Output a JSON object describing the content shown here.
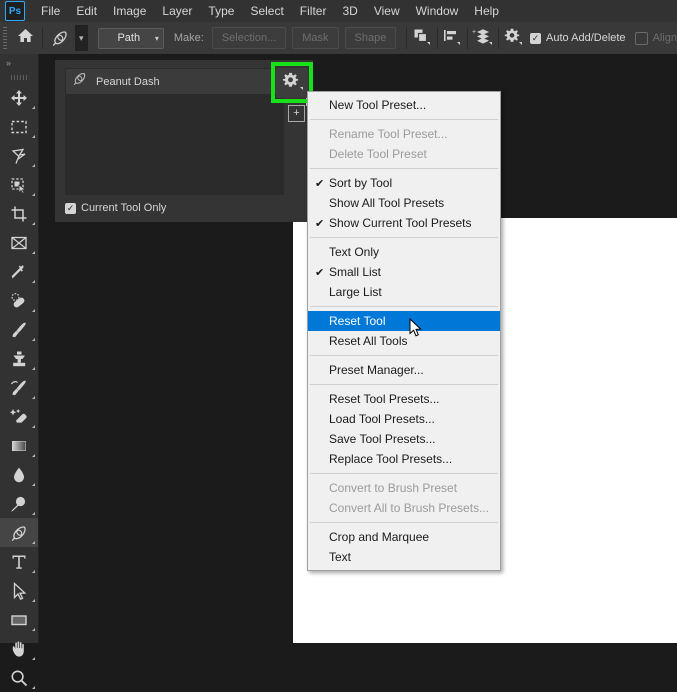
{
  "app": {
    "logo_text": "Ps",
    "menus": [
      "File",
      "Edit",
      "Image",
      "Layer",
      "Type",
      "Select",
      "Filter",
      "3D",
      "View",
      "Window",
      "Help"
    ]
  },
  "options_bar": {
    "home_icon": "home-icon",
    "active_tool_icon": "pen-tool-icon",
    "mode_select": {
      "value": "Path",
      "caret": "⌄"
    },
    "make_label": "Make:",
    "buttons": [
      {
        "label": "Selection...",
        "enabled": false
      },
      {
        "label": "Mask",
        "enabled": false
      },
      {
        "label": "Shape",
        "enabled": false
      }
    ],
    "path_operations_icon": "path-operations-icon",
    "path_alignment_icon": "path-alignment-icon",
    "path_arrangement_icon": "path-arrangement-icon",
    "geometry_options_icon": "gear-icon",
    "auto_add_delete": {
      "label": "Auto Add/Delete",
      "checked": true
    },
    "align": {
      "label": "Align",
      "checked": false,
      "enabled": false
    }
  },
  "toolbar": {
    "collapse_label": "»",
    "tools": [
      {
        "name": "move-tool",
        "icon": "move-icon",
        "selected": false
      },
      {
        "name": "rectangular-marquee-tool",
        "icon": "marquee-icon",
        "selected": false
      },
      {
        "name": "lasso-tool",
        "icon": "lasso-icon",
        "selected": false
      },
      {
        "name": "object-selection-tool",
        "icon": "quick-selection-icon",
        "selected": false
      },
      {
        "name": "crop-tool",
        "icon": "crop-icon",
        "selected": false
      },
      {
        "name": "frame-tool",
        "icon": "frame-icon",
        "selected": false
      },
      {
        "name": "eyedropper-tool",
        "icon": "eyedropper-icon",
        "selected": false
      },
      {
        "name": "spot-healing-brush-tool",
        "icon": "healing-brush-icon",
        "selected": false
      },
      {
        "name": "brush-tool",
        "icon": "brush-icon",
        "selected": false
      },
      {
        "name": "clone-stamp-tool",
        "icon": "clone-stamp-icon",
        "selected": false
      },
      {
        "name": "history-brush-tool",
        "icon": "history-brush-icon",
        "selected": false
      },
      {
        "name": "eraser-tool",
        "icon": "eraser-icon",
        "selected": false
      },
      {
        "name": "gradient-tool",
        "icon": "gradient-icon",
        "selected": false
      },
      {
        "name": "blur-tool",
        "icon": "blur-droplet-icon",
        "selected": false
      },
      {
        "name": "dodge-tool",
        "icon": "dodge-icon",
        "selected": false
      },
      {
        "name": "pen-tool",
        "icon": "pen-tool-icon",
        "selected": true
      },
      {
        "name": "type-tool",
        "icon": "type-icon",
        "selected": false
      },
      {
        "name": "path-selection-tool",
        "icon": "path-selection-arrow-icon",
        "selected": false
      },
      {
        "name": "rectangle-tool",
        "icon": "rectangle-icon",
        "selected": false
      },
      {
        "name": "hand-tool",
        "icon": "hand-icon",
        "selected": false
      },
      {
        "name": "zoom-tool",
        "icon": "zoom-magnifier-icon",
        "selected": false
      }
    ]
  },
  "tool_presets_panel": {
    "presets": [
      {
        "name": "Peanut Dash",
        "icon": "pen-tool-icon",
        "selected": true
      }
    ],
    "current_tool_only": {
      "label": "Current Tool Only",
      "checked": true
    },
    "gear_button_icon": "gear-icon",
    "new_preset_button_icon": "plus-icon",
    "highlight_color": "#18e019"
  },
  "context_menu": {
    "highlight_color": "#0078d7",
    "items": [
      {
        "label": "New Tool Preset...",
        "checked": false,
        "disabled": false,
        "selected": false
      },
      {
        "separator": true
      },
      {
        "label": "Rename Tool Preset...",
        "checked": false,
        "disabled": true,
        "selected": false
      },
      {
        "label": "Delete Tool Preset",
        "checked": false,
        "disabled": true,
        "selected": false
      },
      {
        "separator": true
      },
      {
        "label": "Sort by Tool",
        "checked": true,
        "disabled": false,
        "selected": false
      },
      {
        "label": "Show All Tool Presets",
        "checked": false,
        "disabled": false,
        "selected": false
      },
      {
        "label": "Show Current Tool Presets",
        "checked": true,
        "disabled": false,
        "selected": false
      },
      {
        "separator": true
      },
      {
        "label": "Text Only",
        "checked": false,
        "disabled": false,
        "selected": false
      },
      {
        "label": "Small List",
        "checked": true,
        "disabled": false,
        "selected": false
      },
      {
        "label": "Large List",
        "checked": false,
        "disabled": false,
        "selected": false
      },
      {
        "separator": true
      },
      {
        "label": "Reset Tool",
        "checked": false,
        "disabled": false,
        "selected": true
      },
      {
        "label": "Reset All Tools",
        "checked": false,
        "disabled": false,
        "selected": false
      },
      {
        "separator": true
      },
      {
        "label": "Preset Manager...",
        "checked": false,
        "disabled": false,
        "selected": false
      },
      {
        "separator": true
      },
      {
        "label": "Reset Tool Presets...",
        "checked": false,
        "disabled": false,
        "selected": false
      },
      {
        "label": "Load Tool Presets...",
        "checked": false,
        "disabled": false,
        "selected": false
      },
      {
        "label": "Save Tool Presets...",
        "checked": false,
        "disabled": false,
        "selected": false
      },
      {
        "label": "Replace Tool Presets...",
        "checked": false,
        "disabled": false,
        "selected": false
      },
      {
        "separator": true
      },
      {
        "label": "Convert to Brush Preset",
        "checked": false,
        "disabled": true,
        "selected": false
      },
      {
        "label": "Convert All to Brush Presets...",
        "checked": false,
        "disabled": true,
        "selected": false
      },
      {
        "separator": true
      },
      {
        "label": "Crop and Marquee",
        "checked": false,
        "disabled": false,
        "selected": false
      },
      {
        "label": "Text",
        "checked": false,
        "disabled": false,
        "selected": false
      }
    ]
  },
  "cursor": {
    "icon": "mouse-pointer-icon"
  }
}
